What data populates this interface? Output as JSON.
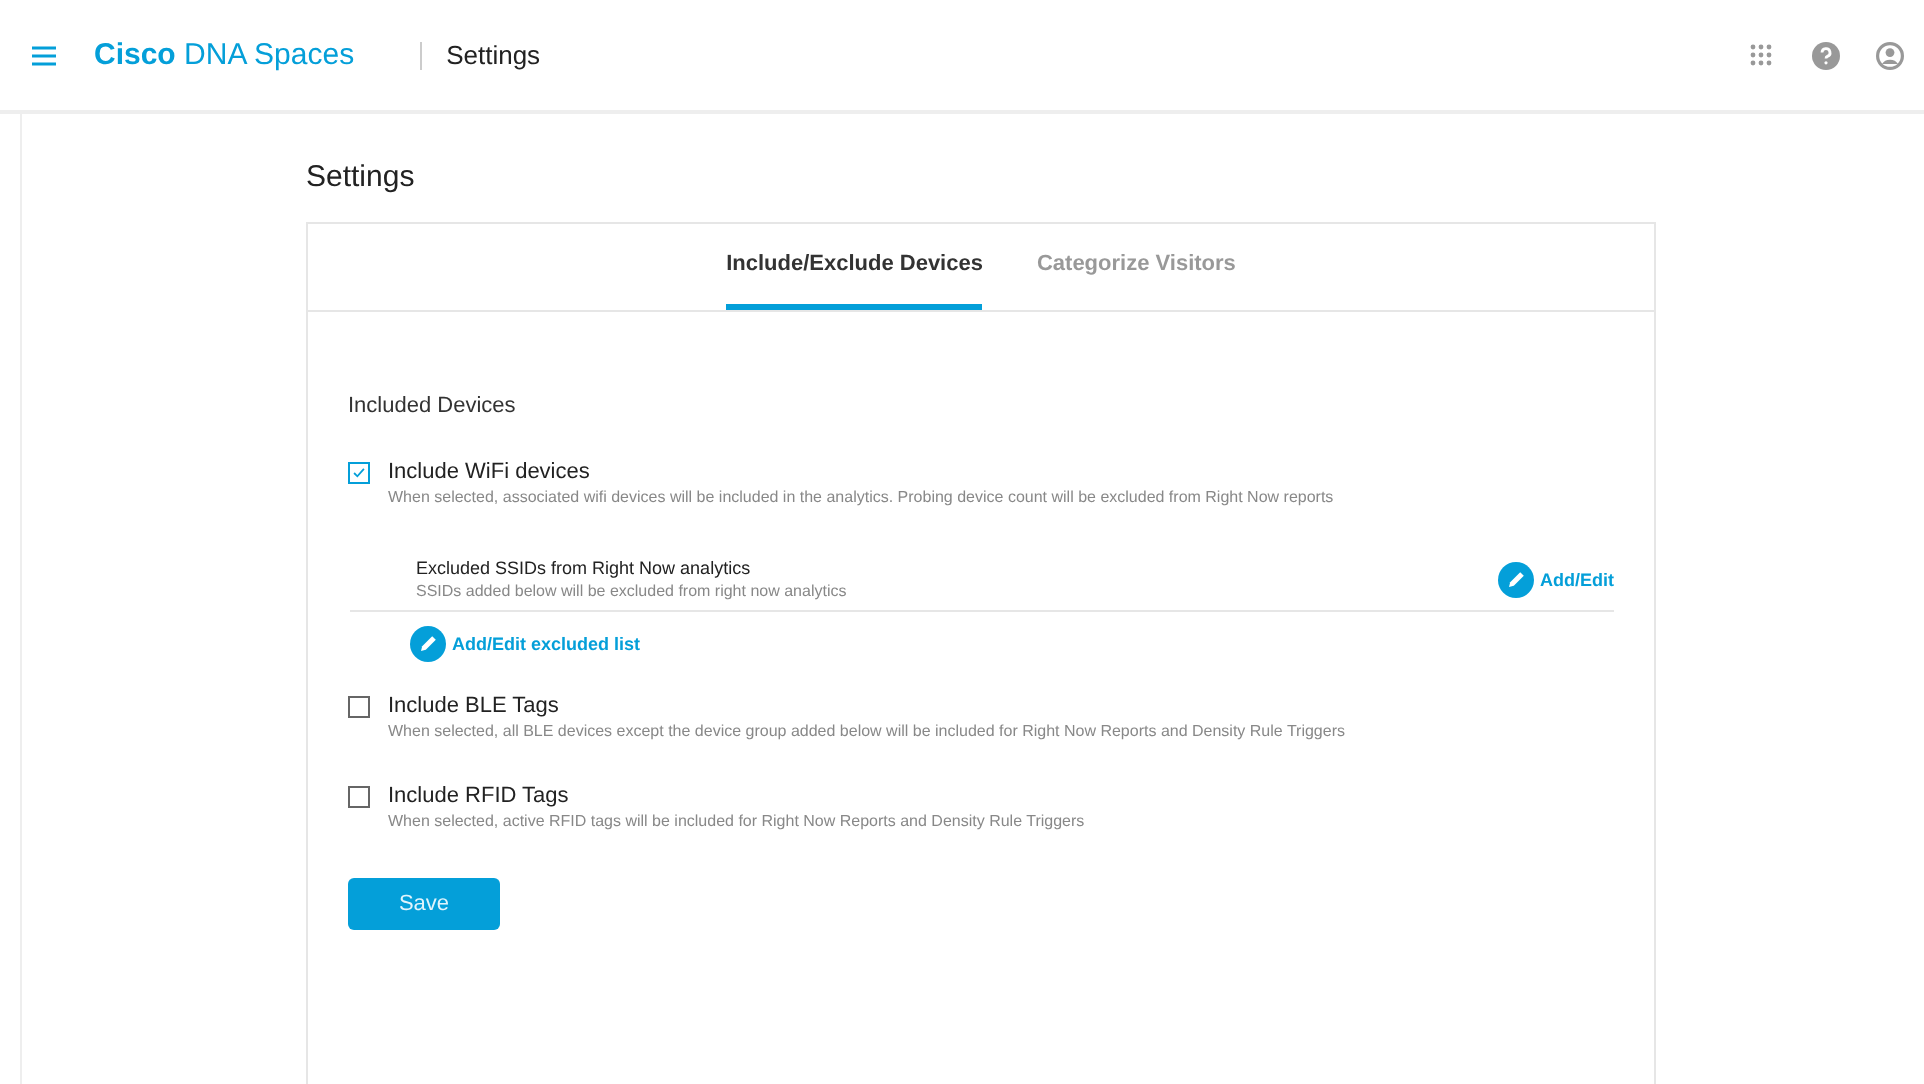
{
  "header": {
    "brand_bold": "Cisco",
    "brand_rest": "DNA Spaces",
    "section": "Settings"
  },
  "page_title": "Settings",
  "tabs": [
    {
      "label": "Include/Exclude Devices",
      "selected": true
    },
    {
      "label": "Categorize Visitors",
      "selected": false
    }
  ],
  "group_title": "Included Devices",
  "options": [
    {
      "label": "Include WiFi devices",
      "description": "When selected, associated wifi devices will be included in the analytics. Probing device count will be excluded from Right Now reports",
      "checked": true,
      "subsection": {
        "title": "Excluded SSIDs from Right Now analytics",
        "description": "SSIDs added below will be excluded from right now analytics",
        "edit_link": "Add/Edit",
        "list_link": "Add/Edit excluded list"
      }
    },
    {
      "label": "Include BLE Tags",
      "description": "When selected, all BLE devices except the device group added below will be included for Right Now Reports and Density Rule Triggers",
      "checked": false
    },
    {
      "label": "Include RFID Tags",
      "description": "When selected, active RFID tags will be included for Right Now Reports and Density Rule Triggers",
      "checked": false
    }
  ],
  "save_button": "Save"
}
